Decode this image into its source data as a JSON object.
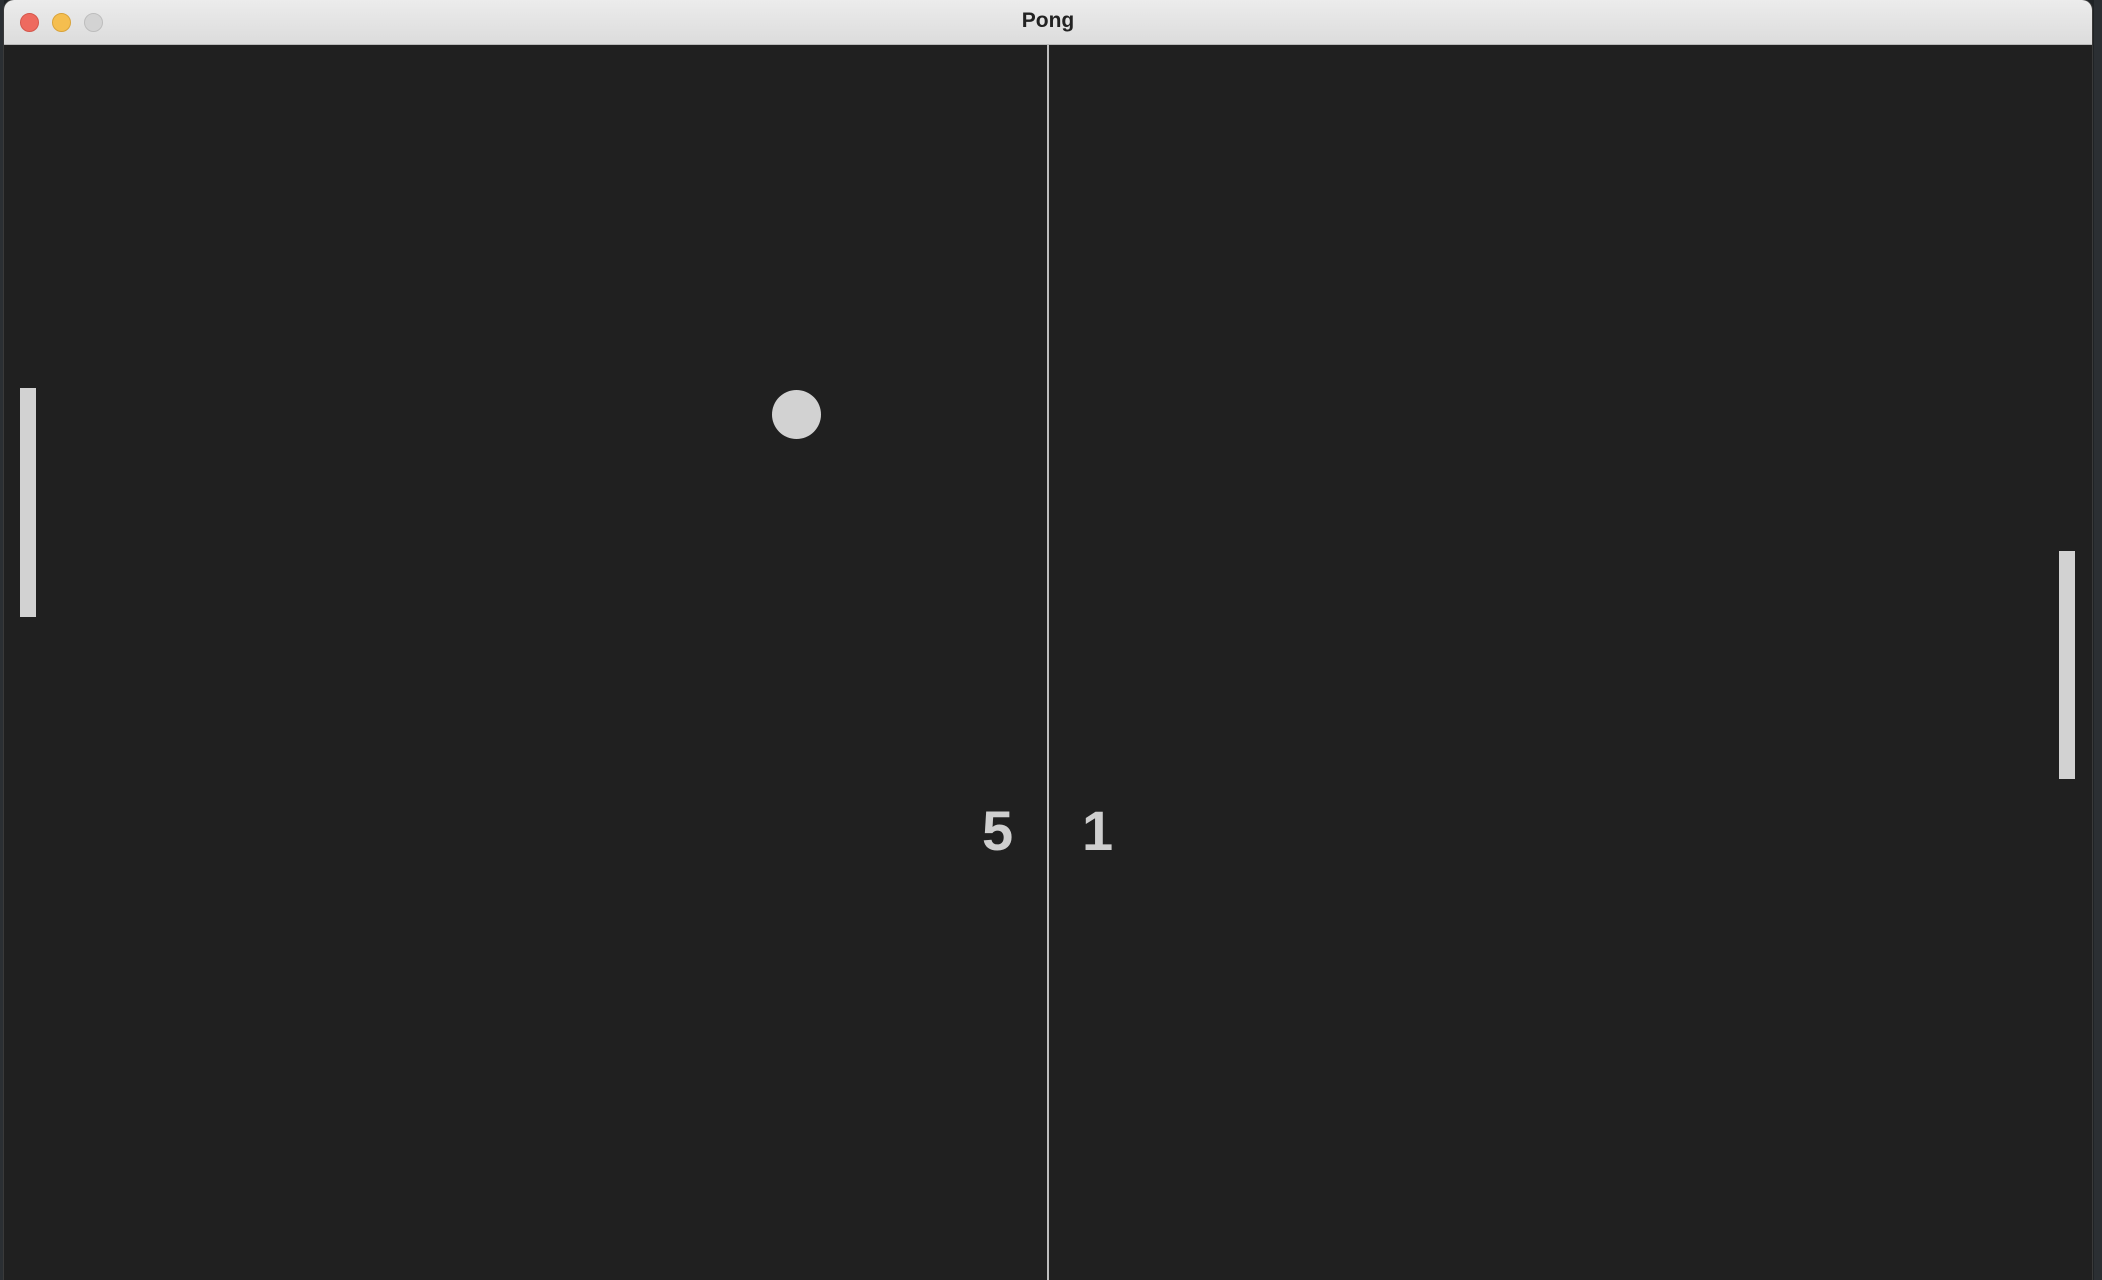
{
  "window": {
    "title": "Pong"
  },
  "game": {
    "left_score": "5",
    "right_score": "1"
  },
  "colors": {
    "background": "#202020",
    "foreground": "#d2d2d2",
    "title_bar": "#e5e5e5",
    "close": "#ee6a5f",
    "minimize": "#f5be4f",
    "zoom": "#d3d3d3"
  }
}
